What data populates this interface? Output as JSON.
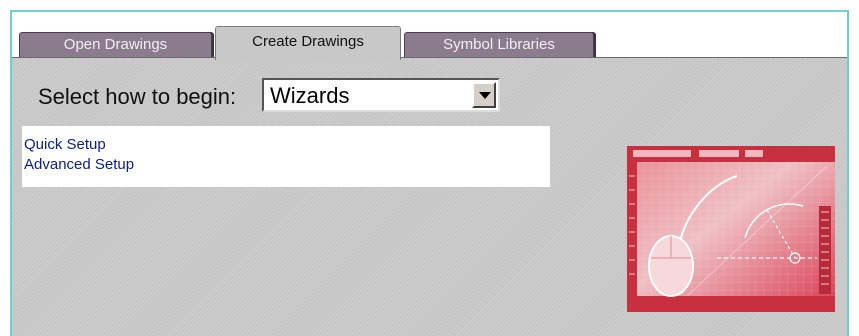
{
  "tabs": [
    {
      "label": "Open Drawings",
      "active": false
    },
    {
      "label": "Create Drawings",
      "active": true
    },
    {
      "label": "Symbol Libraries",
      "active": false
    }
  ],
  "create_panel": {
    "begin_label": "Select how to begin:",
    "begin_select": {
      "value": "Wizards"
    },
    "wizard_list": [
      "Quick Setup",
      "Advanced Setup"
    ]
  },
  "colors": {
    "frame_border": "#6fd0d4",
    "tab_inactive": "#8a7b8d",
    "panel_bg": "#c6c6c6",
    "list_link": "#0a1f8a",
    "preview_accent": "#d8394f"
  },
  "icons": {
    "dropdown": "chevron-down-icon",
    "preview": "drawing-preview-image"
  }
}
